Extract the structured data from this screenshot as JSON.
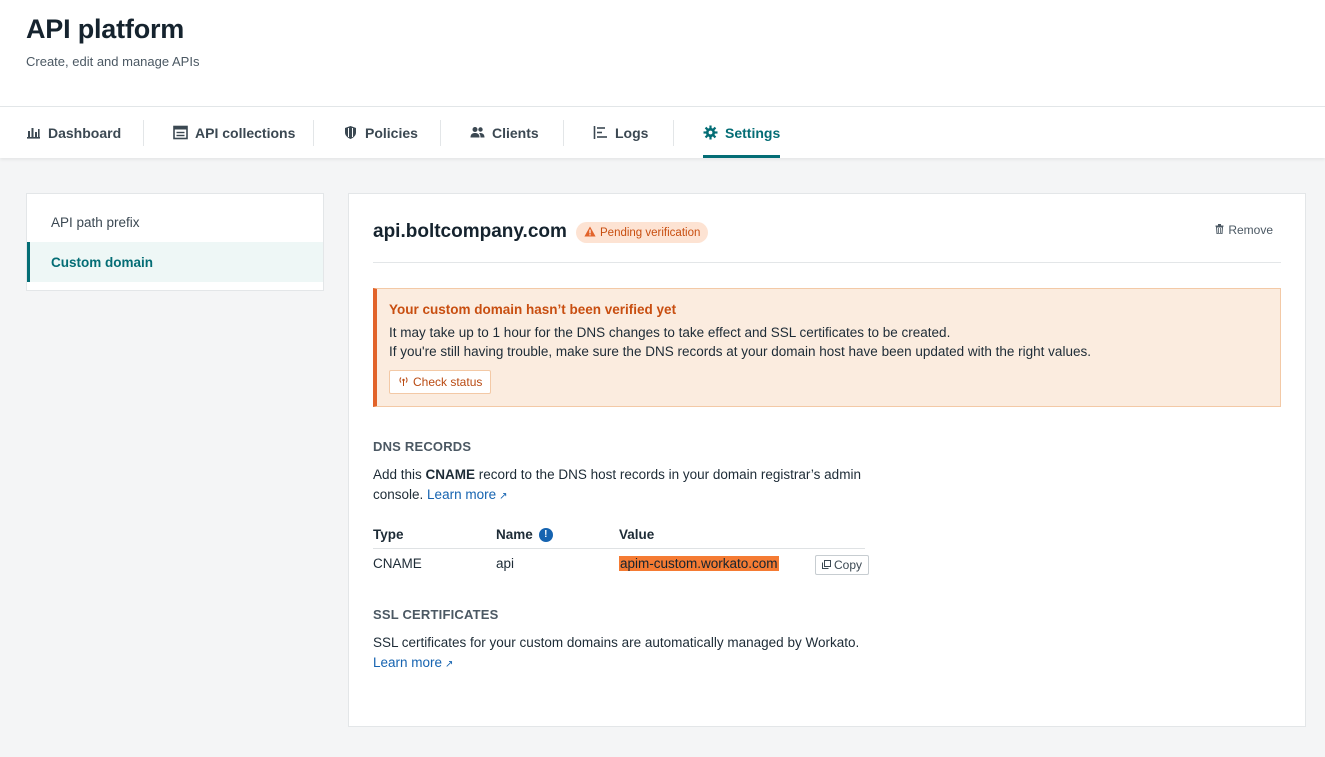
{
  "header": {
    "title": "API platform",
    "subtitle": "Create, edit and manage APIs"
  },
  "tabs": [
    {
      "label": "Dashboard",
      "icon": "bar-chart-icon",
      "active": false
    },
    {
      "label": "API collections",
      "icon": "collection-icon",
      "active": false
    },
    {
      "label": "Policies",
      "icon": "shield-icon",
      "active": false
    },
    {
      "label": "Clients",
      "icon": "users-icon",
      "active": false
    },
    {
      "label": "Logs",
      "icon": "logs-icon",
      "active": false
    },
    {
      "label": "Settings",
      "icon": "gear-icon",
      "active": true
    }
  ],
  "sidebar": {
    "items": [
      {
        "label": "API path prefix",
        "active": false
      },
      {
        "label": "Custom domain",
        "active": true
      }
    ]
  },
  "domain": {
    "name": "api.boltcompany.com",
    "status": "Pending verification",
    "remove_label": "Remove"
  },
  "alert": {
    "title": "Your custom domain hasn’t been verified yet",
    "line1": "It may take up to 1 hour for the DNS changes to take effect and SSL certificates to be created.",
    "line2": "If you're still having trouble, make sure the DNS records at your domain host have been updated with the right values.",
    "button": "Check status"
  },
  "dns": {
    "heading": "DNS RECORDS",
    "text_before": "Add this ",
    "text_bold": "CNAME",
    "text_after": " record to the DNS host records in your domain registrar’s admin",
    "text_line2": "console. ",
    "learn_more": "Learn more",
    "columns": [
      "Type",
      "Name",
      "Value"
    ],
    "row": {
      "type": "CNAME",
      "name": "api",
      "value": "apim-custom.workato.com"
    },
    "copy_label": "Copy"
  },
  "ssl": {
    "heading": "SSL CERTIFICATES",
    "text": "SSL certificates for your custom domains are automatically managed by Workato.",
    "learn_more": "Learn more"
  },
  "colors": {
    "accent": "#046d75",
    "warning": "#e2632a",
    "link": "#1563b0",
    "highlight": "#f57b33"
  }
}
